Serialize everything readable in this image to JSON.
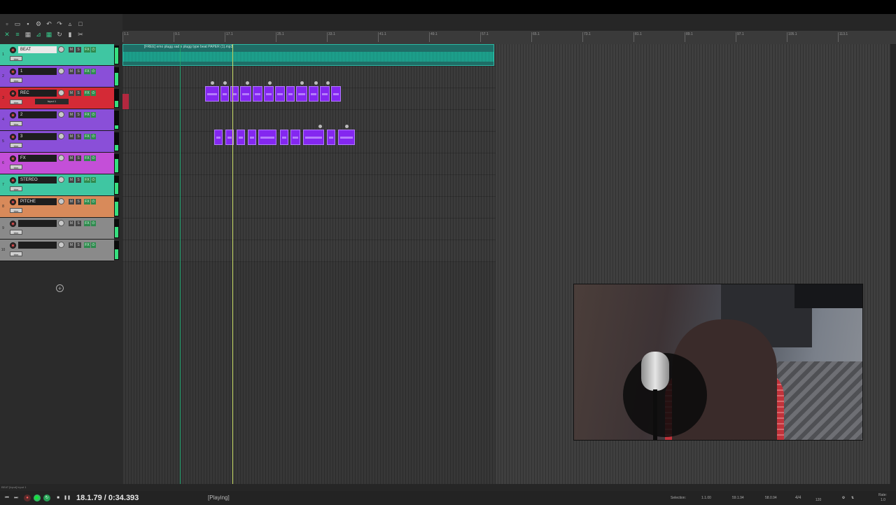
{
  "tracks": [
    {
      "num": "1",
      "name": "BEAT",
      "color": "#3fc6a2",
      "name_style": "lite",
      "auto": "trim"
    },
    {
      "num": "2",
      "name": "1",
      "color": "#8a4fd8",
      "name_style": "dark",
      "auto": "trim"
    },
    {
      "num": "3",
      "name": "REC",
      "color": "#d42a36",
      "name_style": "dark",
      "auto": "trim",
      "input": "Input 1"
    },
    {
      "num": "4",
      "name": "2",
      "color": "#8a4fd8",
      "name_style": "dark",
      "auto": "trim"
    },
    {
      "num": "5",
      "name": "3",
      "color": "#8a4fd8",
      "name_style": "dark",
      "auto": "trim"
    },
    {
      "num": "6",
      "name": "FX",
      "color": "#c44fd8",
      "name_style": "dark",
      "auto": "trim"
    },
    {
      "num": "7",
      "name": "STEREO",
      "color": "#3fc6a2",
      "name_style": "dark",
      "auto": "trim"
    },
    {
      "num": "8",
      "name": "PITCHE",
      "color": "#d88a5a",
      "name_style": "dark",
      "auto": "trim"
    },
    {
      "num": "9",
      "name": "",
      "color": "#8a8a8a",
      "name_style": "dark",
      "auto": "trim"
    },
    {
      "num": "10",
      "name": "",
      "color": "#8a8a8a",
      "name_style": "dark",
      "auto": "trim"
    }
  ],
  "track_buttons": {
    "mute": "M",
    "solo": "S",
    "fx": "FX",
    "power": "⏻"
  },
  "ruler_ticks": [
    "1.1",
    "9.1",
    "17.1",
    "25.1",
    "33.1",
    "41.1",
    "49.1",
    "57.1",
    "65.1",
    "73.1",
    "81.1",
    "89.1",
    "97.1",
    "105.1",
    "113.1"
  ],
  "audio_item_name": "[FREE] emo plugg sad x plugg type beat PAPER (1).mp3",
  "transport": {
    "time": "18.1.79 / 0:34.393",
    "status": "[Playing]",
    "selection_label": "Selection:",
    "sel_start": "1.1.00",
    "sel_end": "59.1.94",
    "sel_length": "58.0.94",
    "time_sig": "4/4",
    "tempo": "120",
    "rate_label": "Rate:",
    "rate": "1.0"
  },
  "bottom_info": "BEAT [input] Input 1",
  "icons": [
    "new-project-icon",
    "open-icon",
    "save-icon",
    "settings-icon",
    "undo-icon",
    "redo-icon",
    "metronome-icon",
    "grid-icon",
    "loop-icon",
    "lock-icon",
    "ripple-icon"
  ],
  "colors": {
    "accent_green": "#36e07f",
    "midi": "#8427f0",
    "audio": "#1f6d66"
  }
}
